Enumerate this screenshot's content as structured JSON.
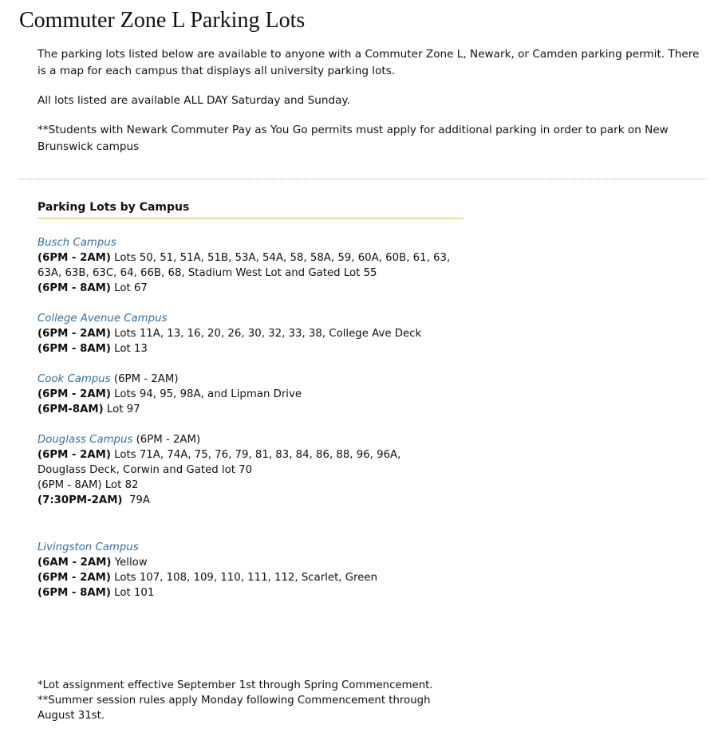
{
  "page": {
    "title": "Commuter Zone L Parking Lots",
    "intro": [
      "The parking lots listed below are available to anyone with a Commuter Zone L, Newark, or Camden parking permit. There is a map for each campus that displays all university parking lots.",
      "All lots listed are available ALL DAY Saturday and Sunday.",
      "**Students with Newark Commuter Pay as You Go permits must apply for additional parking in order to park on New Brunswick campus"
    ],
    "section_title": "Parking Lots by Campus"
  },
  "campuses": {
    "busch": {
      "name": "Busch Campus",
      "l1_hours": "(6PM - 2AM)",
      "l1_text": " Lots 50, 51, 51A, 51B, 53A, 54A, 58, 58A, 59, 60A, 60B, 61, 63, 63A, 63B, 63C, 64, 66B, 68, Stadium West Lot and Gated Lot 55",
      "l2_hours": "(6PM - 8AM)",
      "l2_text": " Lot 67"
    },
    "college_ave": {
      "name": "College Avenue Campus",
      "l1_hours": "(6PM - 2AM)",
      "l1_text": " Lots 11A, 13, 16, 20, 26, 30, 32, 33, 38, College Ave Deck",
      "l2_hours": "(6PM - 8AM)",
      "l2_text": " Lot 13"
    },
    "cook": {
      "name": "Cook Campus",
      "name_suffix": " (6PM - 2AM)",
      "l1_hours": "(6PM - 2AM)",
      "l1_text": " Lots 94, 95, 98A,  and Lipman Drive",
      "l2_hours": "(6PM-8AM)",
      "l2_text": " Lot 97"
    },
    "douglass": {
      "name": "Douglass Campus",
      "name_suffix": " (6PM - 2AM)",
      "l1_hours": "(6PM - 2AM)",
      "l1_text": " Lots 71A, 74A, 75, 76, 79, 81, 83, 84, 86, 88, 96, 96A, Douglass Deck, Corwin and Gated lot 70",
      "l2_plain": "(6PM - 8AM) Lot 82",
      "l3_hours": "(7:30PM-2AM)",
      "l3_text": "  79A"
    },
    "livingston": {
      "name": "Livingston Campus",
      "l1_hours": "(6AM - 2AM)",
      "l1_text": " Yellow",
      "l2_hours": "(6PM - 2AM)",
      "l2_text": " Lots 107, 108, 109, 110, 111, 112, Scarlet, Green",
      "l3_hours": "(6PM - 8AM)",
      "l3_text": " Lot 101"
    }
  },
  "footnotes": [
    "*Lot assignment effective September 1st through Spring Commencement.",
    "**Summer session rules apply Monday following Commencement through August 31st."
  ],
  "colors": {
    "link": "#3a6f9d",
    "rule_gold": "#d6b656",
    "divider": "#b5b5b5"
  }
}
